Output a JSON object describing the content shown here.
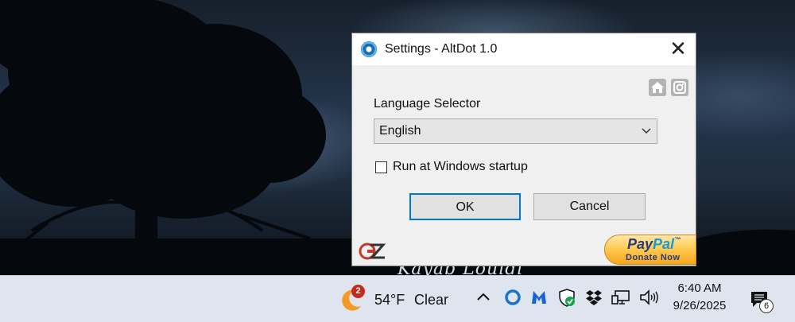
{
  "window": {
    "title": "Settings - AltDot 1.0",
    "close_glyph": "✕",
    "icons": [
      "altdot-app-icon",
      "home-icon",
      "instagram-icon"
    ]
  },
  "settings": {
    "language_label": "Language Selector",
    "language_value": "English",
    "startup_label": "Run at Windows startup",
    "startup_checked": false,
    "ok_label": "OK",
    "cancel_label": "Cancel"
  },
  "footer": {
    "logo": "gz-logo",
    "paypal": {
      "pay": "Pay",
      "pal": "Pal",
      "tm": "™",
      "donate": "Donate Now"
    }
  },
  "desktop": {
    "signature": "Kayab Louidl"
  },
  "taskbar": {
    "weather": {
      "badge": "2",
      "temp": "54°F",
      "condition": "Clear"
    },
    "tray_icons": [
      "chevron-up-icon",
      "cortana-ring-icon",
      "malwarebytes-icon",
      "defender-shield-icon",
      "dropbox-icon",
      "network-icon",
      "volume-icon"
    ],
    "clock": {
      "time": "6:40 AM",
      "date": "9/26/2025"
    },
    "notifications_count": "6"
  },
  "colors": {
    "accent": "#0078d7",
    "taskbar": "#dfe5ee",
    "dialog_bg": "#f0f0f0",
    "badge_red": "#c42b1c"
  }
}
